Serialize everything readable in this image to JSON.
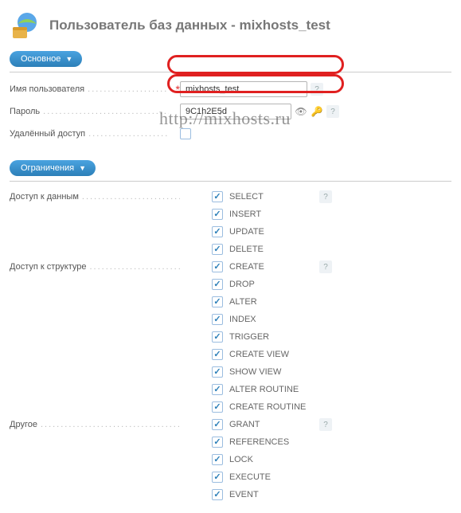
{
  "header": {
    "title": "Пользователь баз данных - mixhosts_test"
  },
  "section_main": {
    "tab": "Основное",
    "username_label": "Имя пользователя",
    "username_value": "mixhosts_test",
    "password_label": "Пароль",
    "password_value": "9C1h2E5d",
    "remote_label": "Удалённый доступ"
  },
  "section_perms": {
    "tab": "Ограничения",
    "groups": [
      {
        "label": "Доступ к данным",
        "privs": [
          "SELECT",
          "INSERT",
          "UPDATE",
          "DELETE"
        ]
      },
      {
        "label": "Доступ к структуре",
        "privs": [
          "CREATE",
          "DROP",
          "ALTER",
          "INDEX",
          "TRIGGER",
          "CREATE VIEW",
          "SHOW VIEW",
          "ALTER ROUTINE",
          "CREATE ROUTINE"
        ]
      },
      {
        "label": "Другое",
        "privs": [
          "GRANT",
          "REFERENCES",
          "LOCK",
          "EXECUTE",
          "EVENT"
        ]
      }
    ]
  },
  "watermark": "http://mixhosts.ru"
}
